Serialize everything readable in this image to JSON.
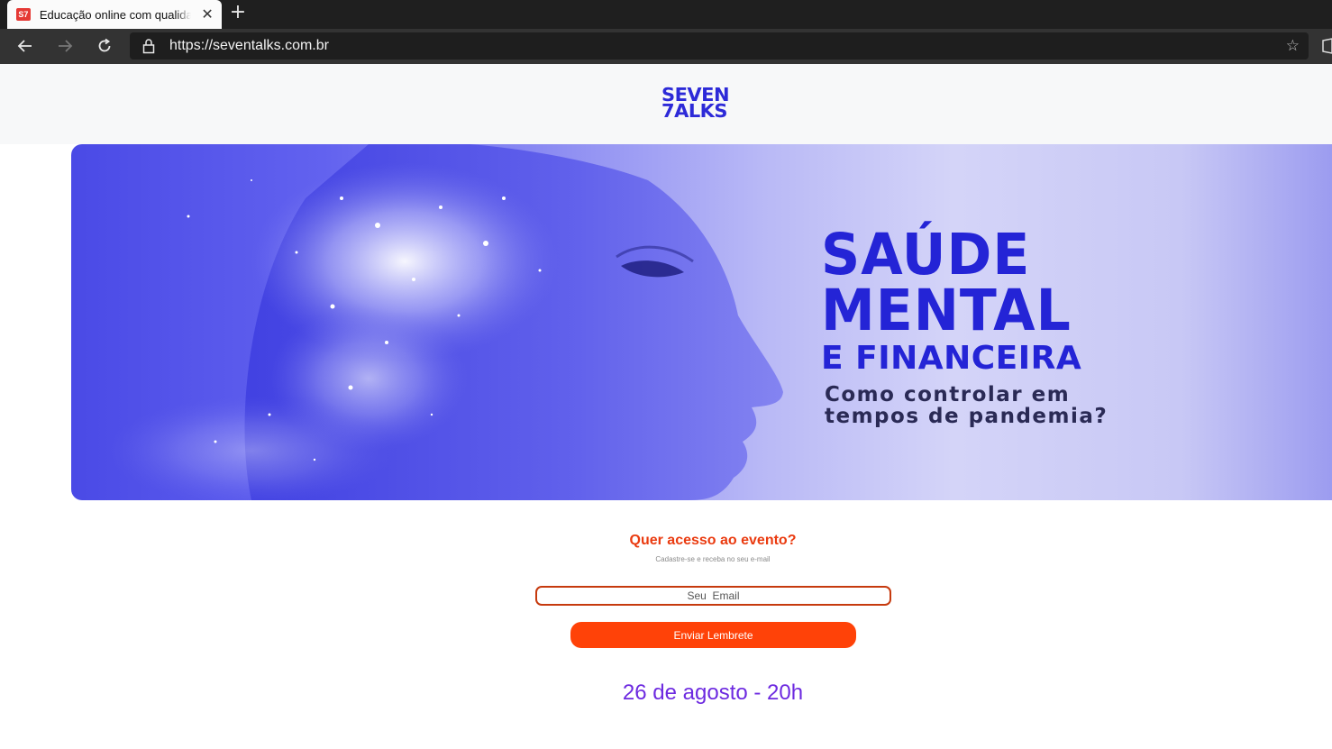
{
  "browser": {
    "tab_title": "Educação online com qualidade | Seven Talks",
    "favicon_text": "S7",
    "url": "https://seventalks.com.br",
    "icons": [
      "back-icon",
      "forward-icon",
      "reload-icon",
      "lock-icon",
      "star-icon",
      "close-icon",
      "plus-icon"
    ]
  },
  "site": {
    "logo_line1": "SEVEN",
    "logo_line2": "7ALKS",
    "hero": {
      "title_line1": "SAÚDE",
      "title_line2": "MENTAL",
      "title_line3": "E FINANCEIRA",
      "subtitle_line1": "Como controlar em",
      "subtitle_line2": "tempos de pandemia?"
    },
    "cta": {
      "title": "Quer acesso ao evento?",
      "subtitle": "Cadastre-se e receba no seu e-mail",
      "email_placeholder": "Seu  Email",
      "button_label": "Enviar Lembrete"
    },
    "event_date": "26 de agosto - 20h"
  },
  "colors": {
    "brand_blue": "#2d2ad8",
    "cta_orange": "#ff4208",
    "cta_title": "#ea3b10",
    "date_purple": "#6d2ae0"
  }
}
